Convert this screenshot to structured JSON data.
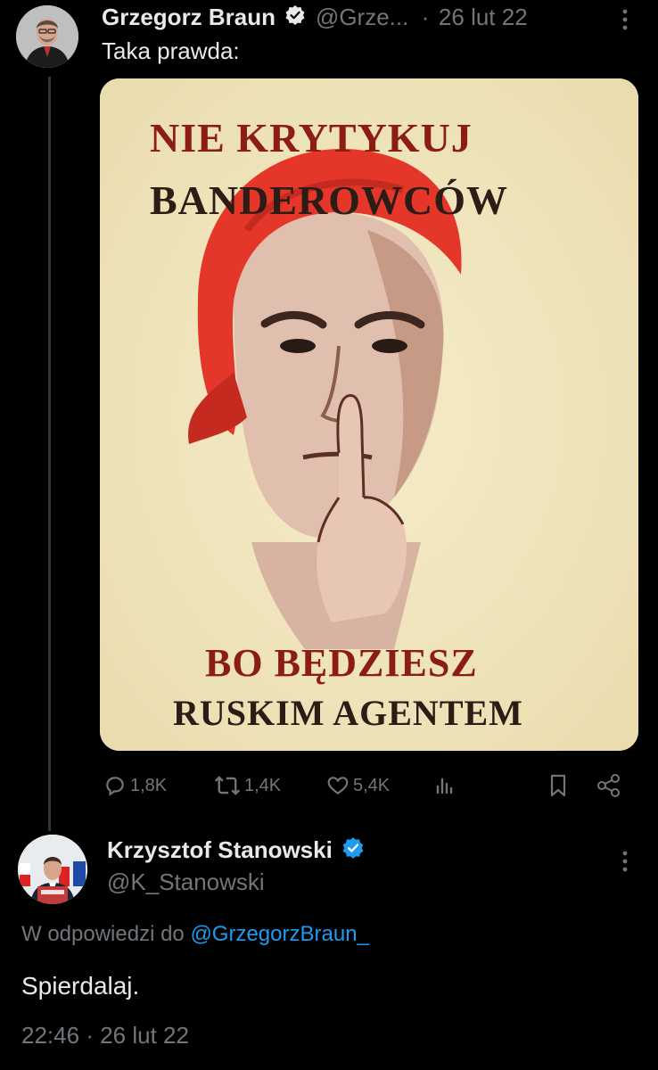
{
  "tweet1": {
    "author_name": "Grzegorz Braun",
    "handle": "@Grze...",
    "separator": "·",
    "date": "26 lut 22",
    "text": "Taka prawda:",
    "poster": {
      "line1": "NIE KRYTYKUJ",
      "line2": "BANDEROWCÓW",
      "line3": "BO BĘDZIESZ",
      "line4": "RUSKIM AGENTEM",
      "headscarf_color": "#e4372a",
      "text_color": "#8b1d12",
      "text_color_dark": "#2b1d16",
      "background_color": "#f1e7bf"
    },
    "actions": {
      "replies": "1,8K",
      "retweets": "1,4K",
      "likes": "5,4K"
    }
  },
  "tweet2": {
    "author_name": "Krzysztof Stanowski",
    "handle": "@K_Stanowski",
    "reply_prefix": "W odpowiedzi do",
    "reply_mention": "@GrzegorzBraun_",
    "text": "Spierdalaj.",
    "time": "22:46",
    "separator": "·",
    "date": "26 lut 22"
  },
  "colors": {
    "background": "#000000",
    "primary_text": "#e7e9ea",
    "secondary_text": "#71767b",
    "accent": "#1d9bf0"
  }
}
